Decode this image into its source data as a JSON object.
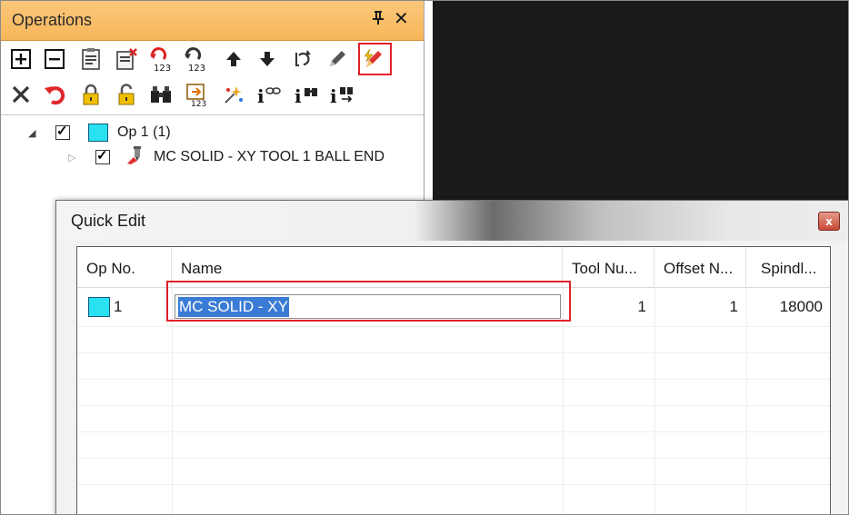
{
  "operations_panel": {
    "title": "Operations",
    "pin_glyph": "ᵰ",
    "close_glyph": "✕",
    "toolbar_row1": [
      {
        "icon": "expand-all-icon"
      },
      {
        "icon": "collapse-all-icon"
      },
      {
        "icon": "clipboard-icon"
      },
      {
        "icon": "delete-clipboard-icon"
      },
      {
        "icon": "renumber-ops-icon",
        "text": "123"
      },
      {
        "icon": "renumber-tools-icon",
        "text": "123"
      },
      {
        "icon": "move-up-icon",
        "glyph": "🡅"
      },
      {
        "icon": "move-down-icon",
        "glyph": "🡇"
      },
      {
        "icon": "regenerate-icon"
      },
      {
        "icon": "pencil-icon"
      },
      {
        "icon": "quick-edit-icon"
      }
    ],
    "toolbar_row2": [
      {
        "icon": "delete-x-icon",
        "glyph": "✕"
      },
      {
        "icon": "undo-icon",
        "glyph": "↶"
      },
      {
        "icon": "lock-closed-icon"
      },
      {
        "icon": "lock-open-icon"
      },
      {
        "icon": "binoculars-icon"
      },
      {
        "icon": "tool-number-icon",
        "text": "123"
      },
      {
        "icon": "sparkle-icon"
      },
      {
        "icon": "info-link-icon",
        "text": "i"
      },
      {
        "icon": "info-binoculars-icon",
        "text": "i"
      },
      {
        "icon": "info-arrows-icon",
        "text": "i"
      }
    ],
    "tree": {
      "op_label": "Op 1  (1)",
      "toolpath_label": "MC SOLID - XY   TOOL 1   BALL END"
    }
  },
  "dialog": {
    "title": "Quick Edit",
    "close_glyph": "x",
    "columns": [
      "Op No.",
      "Name",
      "Tool Nu...",
      "Offset N...",
      "Spindl..."
    ],
    "rows": [
      {
        "op_no": "1",
        "name": "MC SOLID - XY",
        "tool_number": "1",
        "offset_number": "1",
        "spindle": "18000"
      }
    ]
  },
  "colors": {
    "panel_title_bg": "#f7b65a",
    "op_swatch": "#29e1f1",
    "highlight_red": "#e0212a",
    "selection_blue": "#3a7bd5",
    "viewport_bg": "#1b1b1b"
  }
}
